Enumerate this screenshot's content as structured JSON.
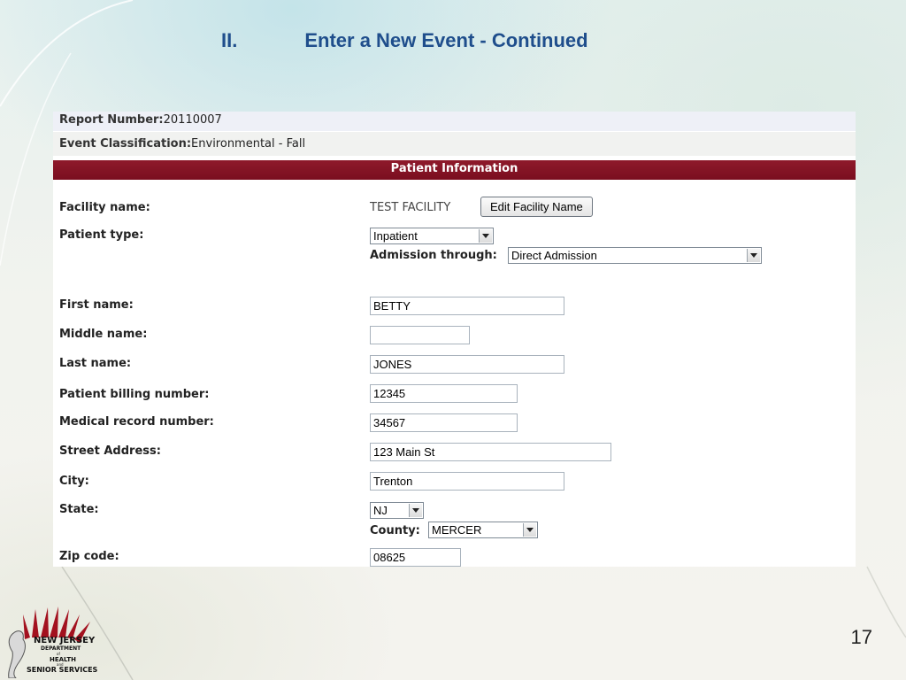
{
  "slide": {
    "number": "II.",
    "title": "Enter a New Event - Continued",
    "page": "17"
  },
  "logo": {
    "line1": "NEW JERSEY",
    "line2": "DEPARTMENT",
    "line3": "of",
    "line4": "HEALTH",
    "line5": "and",
    "line6": "SENIOR SERVICES"
  },
  "report": {
    "number_label": "Report Number:",
    "number_value": "20110007",
    "classification_label": "Event Classification:",
    "classification_value": "Environmental - Fall"
  },
  "section": {
    "title": "Patient Information"
  },
  "form": {
    "facility_label": "Facility name:",
    "facility_value": "TEST FACILITY",
    "edit_facility_button": "Edit Facility Name",
    "patient_type_label": "Patient type:",
    "patient_type_value": "Inpatient",
    "admission_label": "Admission through:",
    "admission_value": "Direct Admission",
    "first_name_label": "First name:",
    "first_name_value": "BETTY",
    "middle_name_label": "Middle name:",
    "middle_name_value": "",
    "last_name_label": "Last name:",
    "last_name_value": "JONES",
    "billing_label": "Patient billing number:",
    "billing_value": "12345",
    "mrn_label": "Medical record number:",
    "mrn_value": "34567",
    "street_label": "Street Address:",
    "street_value": "123 Main St",
    "city_label": "City:",
    "city_value": "Trenton",
    "state_label": "State:",
    "state_value": "NJ",
    "county_label": "County:",
    "county_value": "MERCER",
    "zip_label": "Zip code:",
    "zip_value": "08625"
  },
  "colors": {
    "title_blue": "#1f4e8c",
    "section_bar": "#7a0e1f",
    "logo_red": "#a3111f"
  }
}
